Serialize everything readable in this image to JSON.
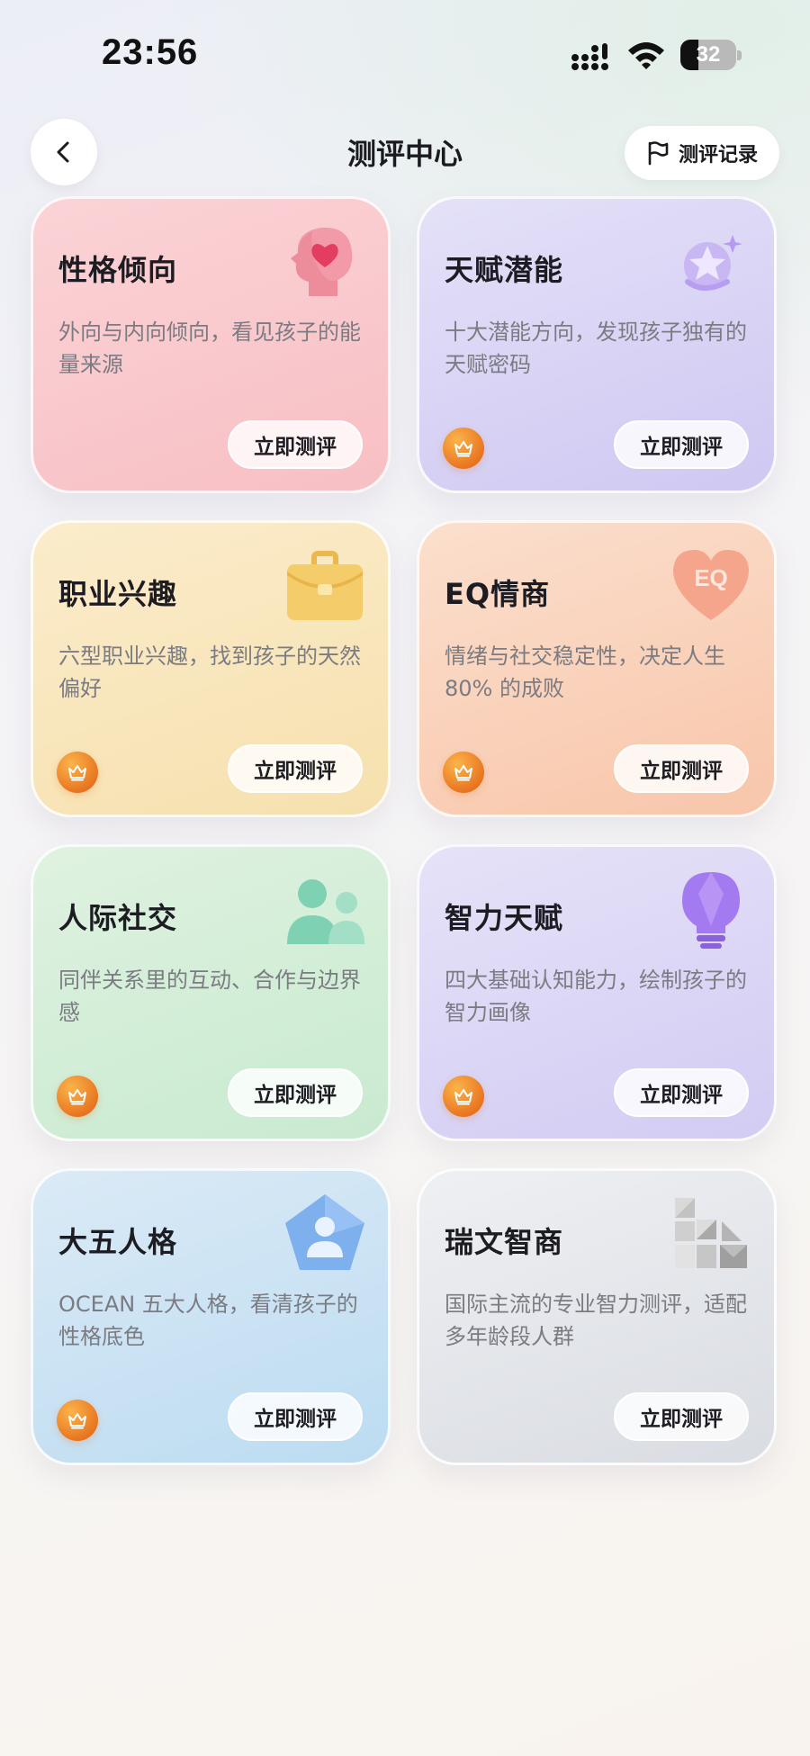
{
  "status_bar": {
    "time": "23:56",
    "battery": "32",
    "battery_level": 0.32
  },
  "header": {
    "title": "测评中心",
    "record_label": "测评记录"
  },
  "colors": {
    "crown": "#ef8a2a",
    "page_bg": "#f5f4f4"
  },
  "cards": [
    {
      "title": "性格倾向",
      "desc": "外向与内向倾向，看见孩子的能量来源",
      "button": "立即测评",
      "icon": "head-heart-icon",
      "premium": false
    },
    {
      "title": "天赋潜能",
      "desc": "十大潜能方向，发现孩子独有的天赋密码",
      "button": "立即测评",
      "icon": "star-sparkle-icon",
      "premium": true
    },
    {
      "title": "职业兴趣",
      "desc": "六型职业兴趣，找到孩子的天然偏好",
      "button": "立即测评",
      "icon": "briefcase-icon",
      "premium": true
    },
    {
      "title": "EQ情商",
      "desc": "情绪与社交稳定性，决定人生80% 的成败",
      "button": "立即测评",
      "icon": "eq-heart-icon",
      "premium": true
    },
    {
      "title": "人际社交",
      "desc": "同伴关系里的互动、合作与边界感",
      "button": "立即测评",
      "icon": "people-icon",
      "premium": true
    },
    {
      "title": "智力天赋",
      "desc": "四大基础认知能力，绘制孩子的智力画像",
      "button": "立即测评",
      "icon": "lightbulb-icon",
      "premium": true
    },
    {
      "title": "大五人格",
      "desc": "OCEAN 五大人格，看清孩子的性格底色",
      "button": "立即测评",
      "icon": "pentagon-person-icon",
      "premium": true
    },
    {
      "title": "瑞文智商",
      "desc": "国际主流的专业智力测评，适配多年龄段人群",
      "button": "立即测评",
      "icon": "matrix-blocks-icon",
      "premium": false
    }
  ]
}
